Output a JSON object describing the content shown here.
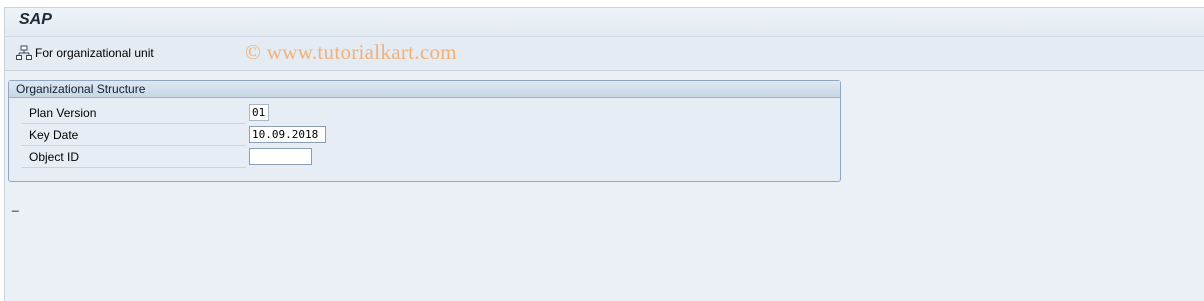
{
  "window": {
    "title": "SAP"
  },
  "toolbar": {
    "org_unit_button_label": "For organizational unit",
    "org_unit_button_icon": "org-hierarchy-icon"
  },
  "watermark": {
    "text": "© www.tutorialkart.com"
  },
  "org_structure": {
    "group_title": "Organizational Structure",
    "fields": [
      {
        "label": "Plan Version",
        "value": "01"
      },
      {
        "label": "Key Date",
        "value": "10.09.2018"
      },
      {
        "label": "Object ID",
        "value": ""
      }
    ]
  },
  "status": {
    "cursor_text": "_"
  },
  "colors": {
    "background": "#eaf0f6",
    "group_border": "#8fa7c0",
    "watermark": "#f0b17a"
  }
}
